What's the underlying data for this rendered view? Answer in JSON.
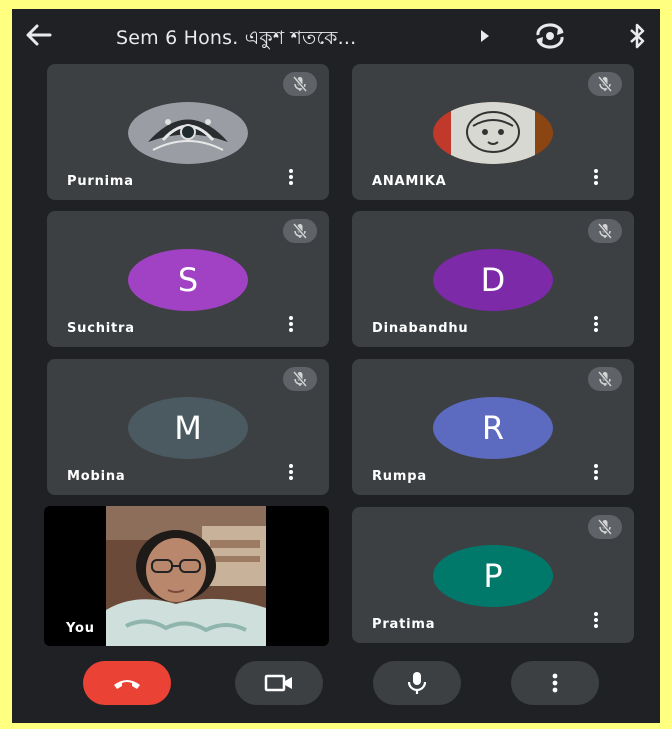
{
  "header": {
    "title": "Sem 6 Hons. একুশ শতকে...",
    "back_icon": "arrow-left-icon",
    "camera_switch_icon": "camera-flip-icon",
    "audio_output_icon": "bluetooth-icon"
  },
  "participants": [
    {
      "name": "Purnima",
      "avatar_type": "photo",
      "muted": true
    },
    {
      "name": "ANAMIKA",
      "avatar_type": "photo",
      "muted": true
    },
    {
      "name": "Suchitra",
      "initial": "S",
      "avatar_color": "#a142c4",
      "muted": true
    },
    {
      "name": "Dinabandhu",
      "initial": "D",
      "avatar_color": "#7c2aa8",
      "muted": true
    },
    {
      "name": "Mobina",
      "initial": "M",
      "avatar_color": "#4a5a60",
      "muted": true
    },
    {
      "name": "Rumpa",
      "initial": "R",
      "avatar_color": "#5c6bc0",
      "muted": true
    },
    {
      "name": "Pratima",
      "initial": "P",
      "avatar_color": "#00796b",
      "muted": true
    }
  ],
  "self_view": {
    "name": "You"
  },
  "controls": {
    "hangup_icon": "phone-hangup-icon",
    "camera_icon": "videocam-icon",
    "mic_icon": "mic-icon",
    "more_icon": "more-vert-icon",
    "hangup_color": "#ea4335"
  },
  "colors": {
    "background": "#202124",
    "tile": "#3c4043",
    "frame": "#ffff80"
  }
}
